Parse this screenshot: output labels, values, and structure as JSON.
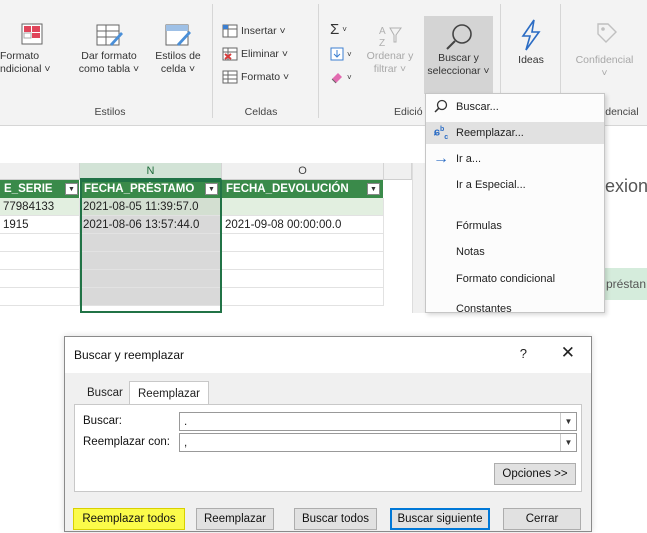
{
  "ribbon": {
    "formato_condicional_1": "Formato",
    "formato_condicional_2": "ndicional ˅",
    "dar_formato_1": "Dar formato",
    "dar_formato_2": "como tabla ˅",
    "estilos_celda_1": "Estilos de",
    "estilos_celda_2": "celda ˅",
    "estilos_group": "Estilos",
    "insertar": "Insertar ˅",
    "eliminar": "Eliminar ˅",
    "formato": "Formato ˅",
    "celdas_group": "Celdas",
    "ordenar_1": "Ordenar y",
    "ordenar_2": "filtrar ˅",
    "edicion_group": "Edició",
    "buscar_1": "Buscar y",
    "buscar_2": "seleccionar ˅",
    "ideas": "Ideas",
    "confidencial": "Confidencial",
    "confidencial_group": "fidencial"
  },
  "menu": {
    "items": [
      {
        "label": "Buscar..."
      },
      {
        "label": "Reemplazar..."
      },
      {
        "label": "Ir a..."
      },
      {
        "label": "Ir a Especial..."
      },
      {
        "label": "Fórmulas"
      },
      {
        "label": "Notas"
      },
      {
        "label": "Formato condicional"
      },
      {
        "label": "Constantes"
      }
    ]
  },
  "sheet": {
    "col_n": "N",
    "col_o": "O",
    "headers": [
      "E_SERIE",
      "FECHA_PRÉSTAMO",
      "FECHA_DEVOLUCIÓN"
    ],
    "rows": [
      [
        "77984133",
        "2021-08-05 11:39:57.0",
        ""
      ],
      [
        "1915",
        "2021-08-06 13:57:44.0",
        "2021-09-08 00:00:00.0"
      ]
    ],
    "side_text_1": "exion",
    "side_text_2": "préstan"
  },
  "dialog": {
    "title": "Buscar y reemplazar",
    "help": "?",
    "close": "✕",
    "tab_buscar": "Buscar",
    "tab_reemplazar": "Reemplazar",
    "buscar_label": "Buscar:",
    "buscar_value": ".",
    "reemplazar_label": "Reemplazar con:",
    "reemplazar_value": ",",
    "opciones": "Opciones >>",
    "btn_reemplazar_todos": "Reemplazar todos",
    "btn_reemplazar": "Reemplazar",
    "btn_buscar_todos": "Buscar todos",
    "btn_buscar_siguiente": "Buscar siguiente",
    "btn_cerrar": "Cerrar"
  },
  "colors": {
    "accent_green": "#217346",
    "header_green": "#3a8a4a",
    "highlight_yellow": "#fbfb4a",
    "focus_blue": "#0078d7"
  }
}
